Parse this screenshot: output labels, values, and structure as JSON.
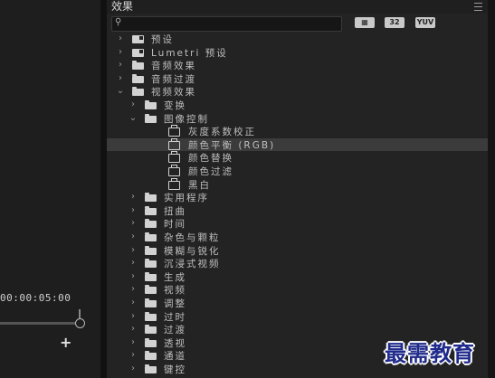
{
  "left_panel": {
    "timecode": "00:00:05:00"
  },
  "effects_panel": {
    "title": "效果",
    "filter_buttons": [
      "▦",
      "32",
      "YUV"
    ],
    "search": {
      "value": "",
      "placeholder": ""
    },
    "tree": [
      {
        "label": "预设",
        "type": "preset-folder",
        "level": 0,
        "expanded": false
      },
      {
        "label": "Lumetri 预设",
        "type": "preset-folder",
        "level": 0,
        "expanded": false
      },
      {
        "label": "音频效果",
        "type": "folder",
        "level": 0,
        "expanded": false
      },
      {
        "label": "音频过渡",
        "type": "folder",
        "level": 0,
        "expanded": false
      },
      {
        "label": "视频效果",
        "type": "folder",
        "level": 0,
        "expanded": true
      },
      {
        "label": "变换",
        "type": "folder",
        "level": 1,
        "expanded": false
      },
      {
        "label": "图像控制",
        "type": "folder",
        "level": 1,
        "expanded": true
      },
      {
        "label": "灰度系数校正",
        "type": "effect",
        "level": 2
      },
      {
        "label": "颜色平衡 (RGB)",
        "type": "effect",
        "level": 2,
        "selected": true
      },
      {
        "label": "颜色替换",
        "type": "effect",
        "level": 2
      },
      {
        "label": "颜色过滤",
        "type": "effect",
        "level": 2
      },
      {
        "label": "黑白",
        "type": "effect",
        "level": 2
      },
      {
        "label": "实用程序",
        "type": "folder",
        "level": 1,
        "expanded": false
      },
      {
        "label": "扭曲",
        "type": "folder",
        "level": 1,
        "expanded": false
      },
      {
        "label": "时间",
        "type": "folder",
        "level": 1,
        "expanded": false
      },
      {
        "label": "杂色与颗粒",
        "type": "folder",
        "level": 1,
        "expanded": false
      },
      {
        "label": "模糊与锐化",
        "type": "folder",
        "level": 1,
        "expanded": false
      },
      {
        "label": "沉浸式视频",
        "type": "folder",
        "level": 1,
        "expanded": false
      },
      {
        "label": "生成",
        "type": "folder",
        "level": 1,
        "expanded": false
      },
      {
        "label": "视频",
        "type": "folder",
        "level": 1,
        "expanded": false
      },
      {
        "label": "调整",
        "type": "folder",
        "level": 1,
        "expanded": false
      },
      {
        "label": "过时",
        "type": "folder",
        "level": 1,
        "expanded": false
      },
      {
        "label": "过渡",
        "type": "folder",
        "level": 1,
        "expanded": false
      },
      {
        "label": "透视",
        "type": "folder",
        "level": 1,
        "expanded": false
      },
      {
        "label": "通道",
        "type": "folder",
        "level": 1,
        "expanded": false
      },
      {
        "label": "键控",
        "type": "folder",
        "level": 1,
        "expanded": false
      }
    ]
  },
  "watermark": "最需教育",
  "colors": {
    "panel_bg": "#232323",
    "selected_row": "#3b3b3b",
    "watermark": "#1f2a8a"
  }
}
